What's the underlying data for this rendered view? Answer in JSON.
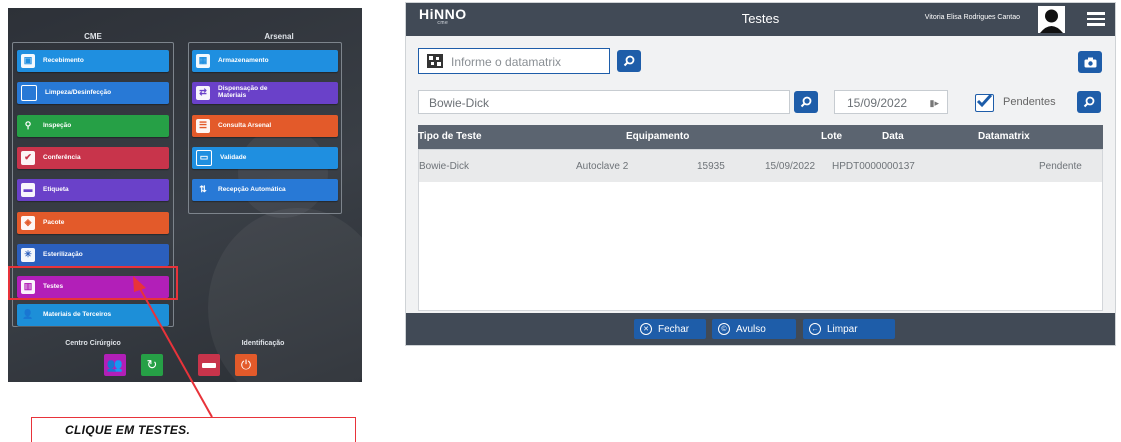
{
  "menu": {
    "cme_title": "CME",
    "arsenal_title": "Arsenal",
    "cme_items": [
      {
        "label": "Recebimento",
        "icon": "box-icon"
      },
      {
        "label": "Limpeza/Desinfecção",
        "icon": "cleaning-icon"
      },
      {
        "label": "Inspeção",
        "icon": "inspection-icon"
      },
      {
        "label": "Conferência",
        "icon": "check-icon"
      },
      {
        "label": "Etiqueta",
        "icon": "label-icon"
      },
      {
        "label": "Pacote",
        "icon": "package-icon"
      },
      {
        "label": "Esterilização",
        "icon": "sterilization-icon"
      },
      {
        "label": "Testes",
        "icon": "tests-icon"
      },
      {
        "label": "Materiais de Terceiros",
        "icon": "user-icon"
      }
    ],
    "arsenal_items": [
      {
        "label": "Armazenamento",
        "icon": "grid-icon"
      },
      {
        "label": "Dispensação de Materiais",
        "icon": "dispense-icon"
      },
      {
        "label": "Consulta Arsenal",
        "icon": "list-icon"
      },
      {
        "label": "Validade",
        "icon": "calendar-icon"
      },
      {
        "label": "Recepção Automática",
        "icon": "updown-arrows-icon"
      }
    ],
    "centro_label": "Centro Cirúrgico",
    "ident_label": "Identificação",
    "callout_text": "CLIQUE EM TESTES."
  },
  "app": {
    "logo": "HiNNO",
    "logo_sub": "cme",
    "title": "Testes",
    "user": "Vitoria Elisa Rodrigues Cantao",
    "datamatrix_placeholder": "Informe o datamatrix",
    "test_filter": "Bowie-Dick",
    "date": "15/09/2022",
    "pendentes_label": "Pendentes",
    "pendentes_checked": true,
    "columns": [
      "Tipo de Teste",
      "Equipamento",
      "Lote",
      "Data",
      "Datamatrix"
    ],
    "rows": [
      {
        "tipo": "Bowie-Dick",
        "equipamento": "Autoclave 2",
        "lote": "15935",
        "data": "15/09/2022",
        "datamatrix": "HPDT0000000137",
        "status": "Pendente"
      }
    ],
    "buttons": {
      "fechar": "Fechar",
      "avulso": "Avulso",
      "limpar": "Limpar"
    }
  },
  "colors": {
    "topbar": "#414a56",
    "accent": "#1e5da9",
    "highlight": "#e8333a"
  }
}
